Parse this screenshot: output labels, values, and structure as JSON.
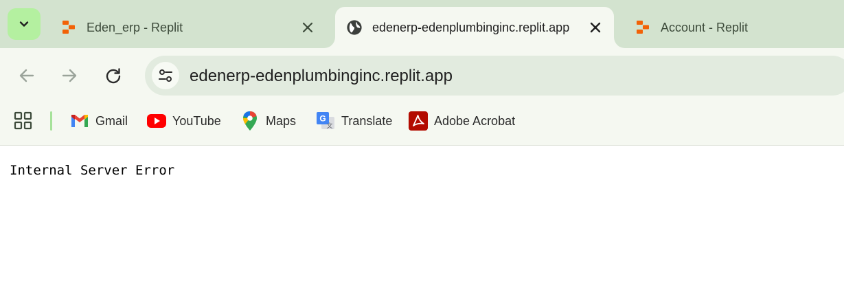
{
  "tabs": [
    {
      "title": "Eden_erp - Replit",
      "icon": "replit-icon",
      "active": false
    },
    {
      "title": "edenerp-edenplumbinginc.replit.app",
      "icon": "globe-icon",
      "active": true
    },
    {
      "title": "Account - Replit",
      "icon": "replit-icon",
      "active": false
    }
  ],
  "toolbar": {
    "url": "edenerp-edenplumbinginc.replit.app"
  },
  "bookmarks": [
    {
      "label": "Gmail",
      "icon": "gmail-icon"
    },
    {
      "label": "YouTube",
      "icon": "youtube-icon"
    },
    {
      "label": "Maps",
      "icon": "maps-icon"
    },
    {
      "label": "Translate",
      "icon": "translate-icon"
    },
    {
      "label": "Adobe Acrobat",
      "icon": "adobe-acrobat-icon"
    }
  ],
  "page": {
    "message": "Internal Server Error"
  },
  "colors": {
    "tabstrip": "#d3e3cf",
    "toolbar": "#f5f8f1",
    "omnibox": "#e2ebdf",
    "accent": "#b4f0a0",
    "replit_orange": "#f26207"
  }
}
